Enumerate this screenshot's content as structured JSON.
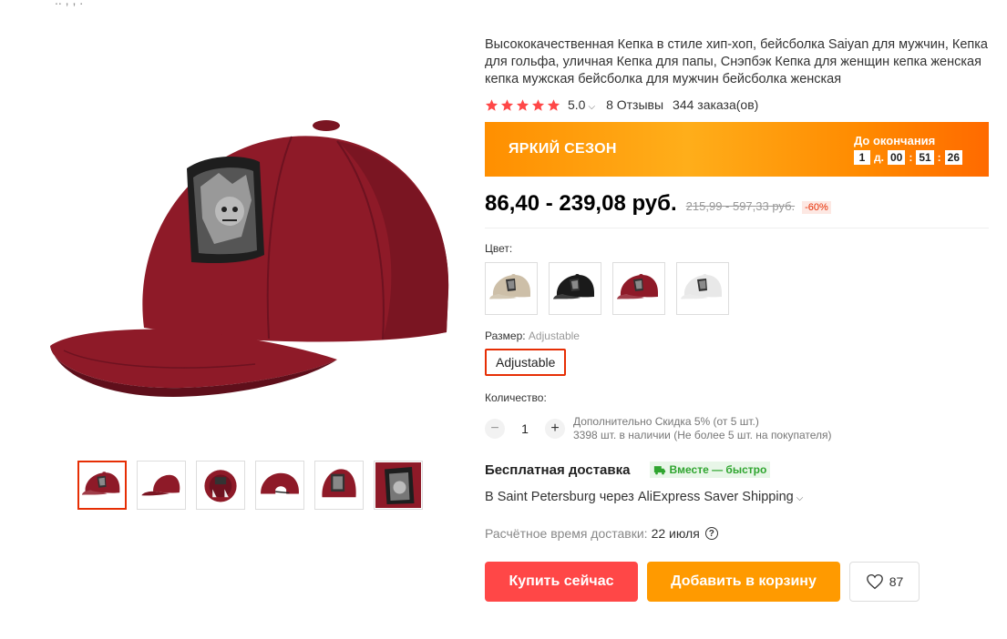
{
  "colors": {
    "accent_red": "#ff4747",
    "accent_orange": "#ff9a00",
    "star": "#ff4747",
    "cap_burgundy": "#8e1a28"
  },
  "gallery": {
    "main_image": "burgundy-baseball-cap-with-skull-patch",
    "thumbnails": [
      {
        "icon": "cap-front-thumb",
        "active": true
      },
      {
        "icon": "cap-side-thumb",
        "active": false
      },
      {
        "icon": "cap-inside-thumb",
        "active": false
      },
      {
        "icon": "cap-back-thumb",
        "active": false
      },
      {
        "icon": "cap-closeup-thumb",
        "active": false
      },
      {
        "icon": "patch-closeup-thumb",
        "active": false
      }
    ]
  },
  "product": {
    "title": "Высококачественная Кепка в стиле хип-хоп, бейсболка Saiyan для мужчин, Кепка для гольфа, уличная Кепка для папы, Снэпбэк Кепка для женщин кепка женская кепка мужская бейсболка для мужчин бейсболка женская",
    "rating": "5.0",
    "reviews": "8 Отзывы",
    "orders": "344 заказа(ов)"
  },
  "promo": {
    "title": "ЯРКИЙ СЕЗОН",
    "countdown_label": "До окончания",
    "days": "1",
    "days_suffix": "д.",
    "hours": "00",
    "minutes": "51",
    "seconds": "26"
  },
  "price": {
    "current": "86,40 - 239,08 руб.",
    "old": "215,99 - 597,33 руб.",
    "discount": "-60%"
  },
  "options": {
    "color_label": "Цвет:",
    "color_swatches": [
      "beige",
      "black",
      "burgundy",
      "white"
    ],
    "size_label": "Размер:",
    "size_selected": "Adjustable",
    "size_value": "Adjustable"
  },
  "quantity": {
    "label": "Количество:",
    "value": "1",
    "minus": "−",
    "plus": "+",
    "discount_note": "Дополнительно Скидка 5% (от 5 шт.)",
    "stock_note": "3398 шт. в наличии (Не более 5 шт. на покупателя)"
  },
  "shipping": {
    "title": "Бесплатная доставка",
    "badge": "Вместе — быстро",
    "via": "В Saint Petersburg через AliExpress Saver Shipping",
    "eta_label": "Расчётное время доставки:",
    "eta_value": "22 июля",
    "help": "?"
  },
  "actions": {
    "buy_now": "Купить сейчас",
    "add_to_cart": "Добавить в корзину",
    "wishlist_count": "87"
  }
}
